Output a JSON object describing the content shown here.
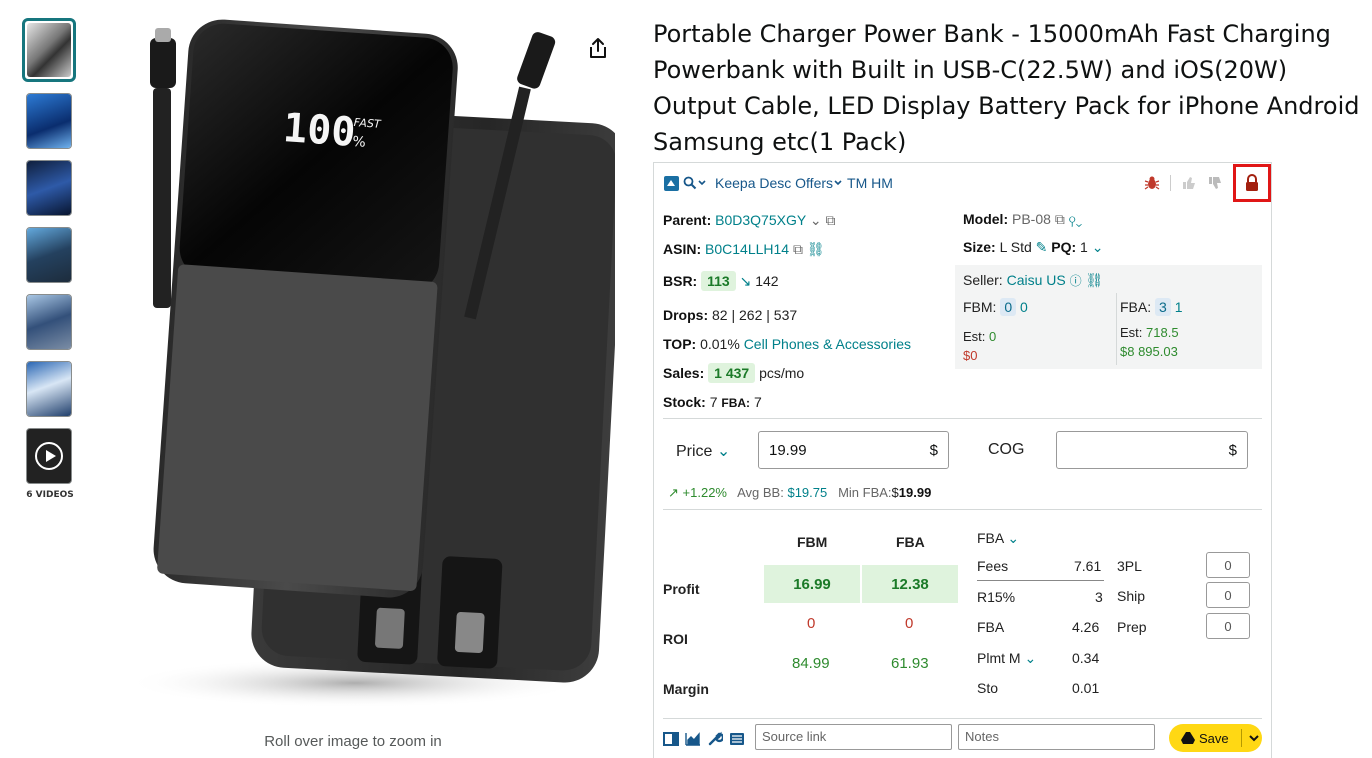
{
  "thumbnails": {
    "video_label": "6 VIDEOS"
  },
  "main_image": {
    "zoom_hint": "Roll over image to zoom in",
    "display_digits": "100",
    "display_fast": "FAST",
    "display_percent": "%"
  },
  "product": {
    "title": "Portable Charger Power Bank - 15000mAh Fast Charging Powerbank with Built in USB-C(22.5W) and iOS(20W) Output Cable, LED Display Battery Pack for iPhone Android Samsung etc(1 Pack)"
  },
  "keepa": {
    "header_label": "Keepa Desc Offers",
    "header_tm": "TM HM",
    "parent_label": "Parent:",
    "parent_value": "B0D3Q75XGY",
    "asin_label": "ASIN:",
    "asin_value": "B0C14LLH14",
    "model_label": "Model:",
    "model_value": "PB-08",
    "size_label": "Size:",
    "size_value": "L Std",
    "pq_label": "PQ:",
    "pq_value": "1",
    "bsr_label": "BSR:",
    "bsr_value": "113",
    "bsr_prev": "142",
    "drops_label": "Drops:",
    "drops_value": "82 | 262 | 537",
    "top_label": "TOP:",
    "top_value": "0.01%",
    "top_category": "Cell Phones & Accessories",
    "sales_label": "Sales:",
    "sales_value": "1 437",
    "sales_unit": "pcs/mo",
    "stock_label": "Stock:",
    "stock_value": "7",
    "stock_fba_label": "FBA:",
    "stock_fba_value": "7",
    "seller_label": "Seller:",
    "seller_name": "Caisu US",
    "fbm_label": "FBM:",
    "fbm_count": "0",
    "fbm_count2": "0",
    "fba_label": "FBA:",
    "fba_count": "3",
    "fba_count2": "1",
    "fbm_est_label": "Est:",
    "fbm_est_value": "0",
    "fbm_est_money": "$0",
    "fba_est_label": "Est:",
    "fba_est_value": "718.5",
    "fba_est_money": "$8 895.03",
    "price_label": "Price",
    "price_value": "19.99",
    "currency": "$",
    "cog_label": "COG",
    "cog_value": "",
    "trend": "+1.22%",
    "avg_bb_label": "Avg BB:",
    "avg_bb_value": "$19.75",
    "min_fba_label": "Min FBA:",
    "min_fba_prefix": "$",
    "min_fba_value": "19.99",
    "col_fbm": "FBM",
    "col_fba": "FBA",
    "profit_label": "Profit",
    "roi_label": "ROI",
    "margin_label": "Margin",
    "profit_fbm": "16.99",
    "profit_fba": "12.38",
    "roi_fbm": "0",
    "roi_fba": "0",
    "margin_fbm": "84.99",
    "margin_fba": "61.93",
    "fees_header": "FBA",
    "fees_label": "Fees",
    "fees_value": "7.61",
    "r15_label": "R15%",
    "r15_value": "3",
    "fba_fee_label": "FBA",
    "fba_fee_value": "4.26",
    "plmt_label": "Plmt M",
    "plmt_value": "0.34",
    "sto_label": "Sto",
    "sto_value": "0.01",
    "tpl_label": "3PL",
    "tpl_value": "0",
    "ship_label": "Ship",
    "ship_value": "0",
    "prep_label": "Prep",
    "prep_value": "0",
    "source_placeholder": "Source link",
    "notes_placeholder": "Notes",
    "save_label": "Save"
  }
}
